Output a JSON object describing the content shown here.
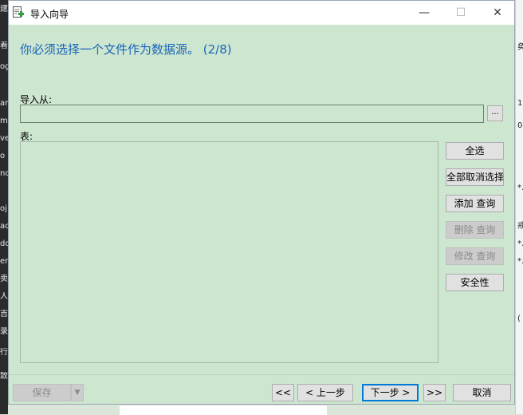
{
  "window": {
    "title": "导入向导",
    "minimize_glyph": "—",
    "maximize_glyph": "☐",
    "close_glyph": "✕"
  },
  "wizard": {
    "heading": "你必须选择一个文件作为数据源。 (2/8)",
    "import_from_label": "导入从:",
    "import_from_value": "",
    "browse_label": "...",
    "tables_label": "表:"
  },
  "side_buttons": {
    "select_all": "全选",
    "deselect_all": "全部取消选择",
    "add_query": "添加 查询",
    "delete_query": "删除 查询",
    "modify_query": "修改 查询",
    "security": "安全性"
  },
  "footer": {
    "save": "保存",
    "first": "<<",
    "prev": "< 上一步",
    "next": "下一步 >",
    "last": ">>",
    "cancel": "取消"
  },
  "icons": {
    "title_icon": "import-document-icon",
    "save_dropdown": "chevron-down-icon"
  }
}
